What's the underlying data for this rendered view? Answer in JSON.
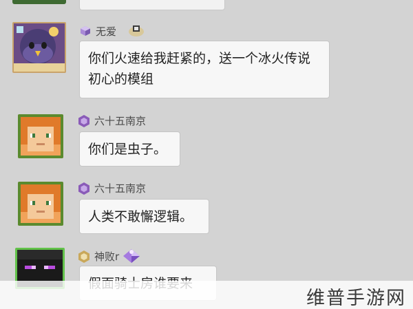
{
  "messages": [
    {
      "sender": "无爱",
      "text": "你们火速给我赶紧的，送一个冰火传说初心的模组"
    },
    {
      "sender": "六十五南京",
      "text": "你们是虫子。"
    },
    {
      "sender": "六十五南京",
      "text": "人类不敢懈逻辑。"
    },
    {
      "sender": "神败r",
      "text": "假面骑士房谁要来"
    }
  ],
  "watermark": "维普手游网",
  "colors": {
    "background": "#d3d3d3",
    "bubble": "#f7f7f7",
    "badge_purple": "#8a5bb8",
    "badge_gold": "#c9a85a"
  },
  "icons": {
    "badge_msg1": "purple-cube-icon",
    "badge_msg2": "purple-hex-badge-icon",
    "badge_msg3": "purple-hex-badge-icon",
    "badge_msg4": "gold-hex-badge-icon",
    "extra_msg1": "ornament-icon",
    "extra_msg4": "purple-gem-icon"
  }
}
